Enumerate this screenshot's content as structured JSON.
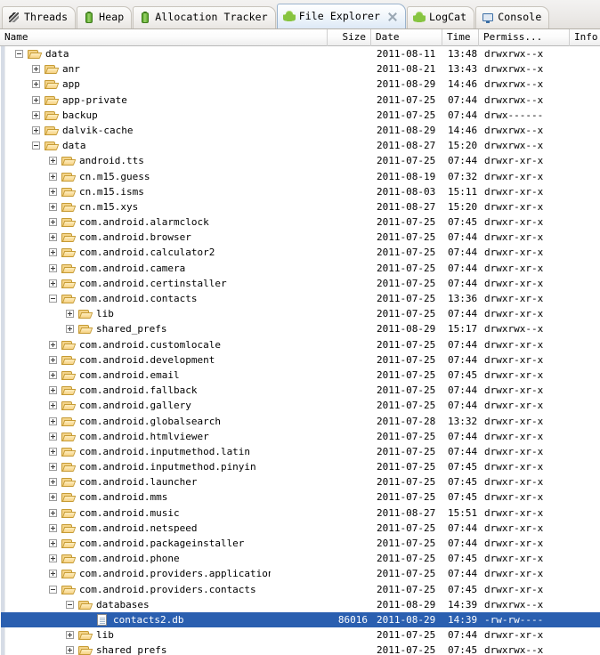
{
  "tabs": [
    {
      "label": "Threads",
      "icon": "threads-icon",
      "active": false,
      "closable": false
    },
    {
      "label": "Heap",
      "icon": "heap-icon",
      "active": false,
      "closable": false
    },
    {
      "label": "Allocation Tracker",
      "icon": "heap-icon",
      "active": false,
      "closable": false
    },
    {
      "label": "File Explorer",
      "icon": "android-icon",
      "active": true,
      "closable": true
    },
    {
      "label": "LogCat",
      "icon": "android-icon",
      "active": false,
      "closable": false
    },
    {
      "label": "Console",
      "icon": "console-icon",
      "active": false,
      "closable": false
    }
  ],
  "columns": [
    {
      "label": "Name",
      "align": "left"
    },
    {
      "label": "Size",
      "align": "right"
    },
    {
      "label": "Date",
      "align": "left"
    },
    {
      "label": "Time",
      "align": "left"
    },
    {
      "label": "Permiss...",
      "align": "left"
    },
    {
      "label": "Info",
      "align": "left"
    }
  ],
  "colors": {
    "selection": "#2a5fb0",
    "folder": "#f4d48a",
    "android_green": "#87c440"
  },
  "rows": [
    {
      "depth": 0,
      "icon": "folder-icon",
      "expander": "minus",
      "name": "data",
      "size": "",
      "date": "2011-08-11",
      "time": "13:48",
      "perm": "drwxrwx--x",
      "info": "",
      "selected": false
    },
    {
      "depth": 1,
      "icon": "folder-icon",
      "expander": "plus",
      "name": "anr",
      "size": "",
      "date": "2011-08-21",
      "time": "13:43",
      "perm": "drwxrwx--x",
      "info": "",
      "selected": false
    },
    {
      "depth": 1,
      "icon": "folder-icon",
      "expander": "plus",
      "name": "app",
      "size": "",
      "date": "2011-08-29",
      "time": "14:46",
      "perm": "drwxrwx--x",
      "info": "",
      "selected": false
    },
    {
      "depth": 1,
      "icon": "folder-icon",
      "expander": "plus",
      "name": "app-private",
      "size": "",
      "date": "2011-07-25",
      "time": "07:44",
      "perm": "drwxrwx--x",
      "info": "",
      "selected": false
    },
    {
      "depth": 1,
      "icon": "folder-icon",
      "expander": "plus",
      "name": "backup",
      "size": "",
      "date": "2011-07-25",
      "time": "07:44",
      "perm": "drwx------",
      "info": "",
      "selected": false
    },
    {
      "depth": 1,
      "icon": "folder-icon",
      "expander": "plus",
      "name": "dalvik-cache",
      "size": "",
      "date": "2011-08-29",
      "time": "14:46",
      "perm": "drwxrwx--x",
      "info": "",
      "selected": false
    },
    {
      "depth": 1,
      "icon": "folder-icon",
      "expander": "minus",
      "name": "data",
      "size": "",
      "date": "2011-08-27",
      "time": "15:20",
      "perm": "drwxrwx--x",
      "info": "",
      "selected": false
    },
    {
      "depth": 2,
      "icon": "folder-icon",
      "expander": "plus",
      "name": "android.tts",
      "size": "",
      "date": "2011-07-25",
      "time": "07:44",
      "perm": "drwxr-xr-x",
      "info": "",
      "selected": false
    },
    {
      "depth": 2,
      "icon": "folder-icon",
      "expander": "plus",
      "name": "cn.m15.guess",
      "size": "",
      "date": "2011-08-19",
      "time": "07:32",
      "perm": "drwxr-xr-x",
      "info": "",
      "selected": false
    },
    {
      "depth": 2,
      "icon": "folder-icon",
      "expander": "plus",
      "name": "cn.m15.isms",
      "size": "",
      "date": "2011-08-03",
      "time": "15:11",
      "perm": "drwxr-xr-x",
      "info": "",
      "selected": false
    },
    {
      "depth": 2,
      "icon": "folder-icon",
      "expander": "plus",
      "name": "cn.m15.xys",
      "size": "",
      "date": "2011-08-27",
      "time": "15:20",
      "perm": "drwxr-xr-x",
      "info": "",
      "selected": false
    },
    {
      "depth": 2,
      "icon": "folder-icon",
      "expander": "plus",
      "name": "com.android.alarmclock",
      "size": "",
      "date": "2011-07-25",
      "time": "07:45",
      "perm": "drwxr-xr-x",
      "info": "",
      "selected": false
    },
    {
      "depth": 2,
      "icon": "folder-icon",
      "expander": "plus",
      "name": "com.android.browser",
      "size": "",
      "date": "2011-07-25",
      "time": "07:44",
      "perm": "drwxr-xr-x",
      "info": "",
      "selected": false
    },
    {
      "depth": 2,
      "icon": "folder-icon",
      "expander": "plus",
      "name": "com.android.calculator2",
      "size": "",
      "date": "2011-07-25",
      "time": "07:44",
      "perm": "drwxr-xr-x",
      "info": "",
      "selected": false
    },
    {
      "depth": 2,
      "icon": "folder-icon",
      "expander": "plus",
      "name": "com.android.camera",
      "size": "",
      "date": "2011-07-25",
      "time": "07:44",
      "perm": "drwxr-xr-x",
      "info": "",
      "selected": false
    },
    {
      "depth": 2,
      "icon": "folder-icon",
      "expander": "plus",
      "name": "com.android.certinstaller",
      "size": "",
      "date": "2011-07-25",
      "time": "07:44",
      "perm": "drwxr-xr-x",
      "info": "",
      "selected": false
    },
    {
      "depth": 2,
      "icon": "folder-icon",
      "expander": "minus",
      "name": "com.android.contacts",
      "size": "",
      "date": "2011-07-25",
      "time": "13:36",
      "perm": "drwxr-xr-x",
      "info": "",
      "selected": false
    },
    {
      "depth": 3,
      "icon": "folder-icon",
      "expander": "plus",
      "name": "lib",
      "size": "",
      "date": "2011-07-25",
      "time": "07:44",
      "perm": "drwxr-xr-x",
      "info": "",
      "selected": false
    },
    {
      "depth": 3,
      "icon": "folder-icon",
      "expander": "plus",
      "name": "shared_prefs",
      "size": "",
      "date": "2011-08-29",
      "time": "15:17",
      "perm": "drwxrwx--x",
      "info": "",
      "selected": false
    },
    {
      "depth": 2,
      "icon": "folder-icon",
      "expander": "plus",
      "name": "com.android.customlocale",
      "size": "",
      "date": "2011-07-25",
      "time": "07:44",
      "perm": "drwxr-xr-x",
      "info": "",
      "selected": false
    },
    {
      "depth": 2,
      "icon": "folder-icon",
      "expander": "plus",
      "name": "com.android.development",
      "size": "",
      "date": "2011-07-25",
      "time": "07:44",
      "perm": "drwxr-xr-x",
      "info": "",
      "selected": false
    },
    {
      "depth": 2,
      "icon": "folder-icon",
      "expander": "plus",
      "name": "com.android.email",
      "size": "",
      "date": "2011-07-25",
      "time": "07:45",
      "perm": "drwxr-xr-x",
      "info": "",
      "selected": false
    },
    {
      "depth": 2,
      "icon": "folder-icon",
      "expander": "plus",
      "name": "com.android.fallback",
      "size": "",
      "date": "2011-07-25",
      "time": "07:44",
      "perm": "drwxr-xr-x",
      "info": "",
      "selected": false
    },
    {
      "depth": 2,
      "icon": "folder-icon",
      "expander": "plus",
      "name": "com.android.gallery",
      "size": "",
      "date": "2011-07-25",
      "time": "07:44",
      "perm": "drwxr-xr-x",
      "info": "",
      "selected": false
    },
    {
      "depth": 2,
      "icon": "folder-icon",
      "expander": "plus",
      "name": "com.android.globalsearch",
      "size": "",
      "date": "2011-07-28",
      "time": "13:32",
      "perm": "drwxr-xr-x",
      "info": "",
      "selected": false
    },
    {
      "depth": 2,
      "icon": "folder-icon",
      "expander": "plus",
      "name": "com.android.htmlviewer",
      "size": "",
      "date": "2011-07-25",
      "time": "07:44",
      "perm": "drwxr-xr-x",
      "info": "",
      "selected": false
    },
    {
      "depth": 2,
      "icon": "folder-icon",
      "expander": "plus",
      "name": "com.android.inputmethod.latin",
      "size": "",
      "date": "2011-07-25",
      "time": "07:44",
      "perm": "drwxr-xr-x",
      "info": "",
      "selected": false
    },
    {
      "depth": 2,
      "icon": "folder-icon",
      "expander": "plus",
      "name": "com.android.inputmethod.pinyin",
      "size": "",
      "date": "2011-07-25",
      "time": "07:45",
      "perm": "drwxr-xr-x",
      "info": "",
      "selected": false
    },
    {
      "depth": 2,
      "icon": "folder-icon",
      "expander": "plus",
      "name": "com.android.launcher",
      "size": "",
      "date": "2011-07-25",
      "time": "07:45",
      "perm": "drwxr-xr-x",
      "info": "",
      "selected": false
    },
    {
      "depth": 2,
      "icon": "folder-icon",
      "expander": "plus",
      "name": "com.android.mms",
      "size": "",
      "date": "2011-07-25",
      "time": "07:45",
      "perm": "drwxr-xr-x",
      "info": "",
      "selected": false
    },
    {
      "depth": 2,
      "icon": "folder-icon",
      "expander": "plus",
      "name": "com.android.music",
      "size": "",
      "date": "2011-08-27",
      "time": "15:51",
      "perm": "drwxr-xr-x",
      "info": "",
      "selected": false
    },
    {
      "depth": 2,
      "icon": "folder-icon",
      "expander": "plus",
      "name": "com.android.netspeed",
      "size": "",
      "date": "2011-07-25",
      "time": "07:44",
      "perm": "drwxr-xr-x",
      "info": "",
      "selected": false
    },
    {
      "depth": 2,
      "icon": "folder-icon",
      "expander": "plus",
      "name": "com.android.packageinstaller",
      "size": "",
      "date": "2011-07-25",
      "time": "07:44",
      "perm": "drwxr-xr-x",
      "info": "",
      "selected": false
    },
    {
      "depth": 2,
      "icon": "folder-icon",
      "expander": "plus",
      "name": "com.android.phone",
      "size": "",
      "date": "2011-07-25",
      "time": "07:45",
      "perm": "drwxr-xr-x",
      "info": "",
      "selected": false
    },
    {
      "depth": 2,
      "icon": "folder-icon",
      "expander": "plus",
      "name": "com.android.providers.applications",
      "size": "",
      "date": "2011-07-25",
      "time": "07:44",
      "perm": "drwxr-xr-x",
      "info": "",
      "selected": false
    },
    {
      "depth": 2,
      "icon": "folder-icon",
      "expander": "minus",
      "name": "com.android.providers.contacts",
      "size": "",
      "date": "2011-07-25",
      "time": "07:45",
      "perm": "drwxr-xr-x",
      "info": "",
      "selected": false
    },
    {
      "depth": 3,
      "icon": "folder-icon",
      "expander": "minus",
      "name": "databases",
      "size": "",
      "date": "2011-08-29",
      "time": "14:39",
      "perm": "drwxrwx--x",
      "info": "",
      "selected": false
    },
    {
      "depth": 4,
      "icon": "file-icon",
      "expander": "none",
      "name": "contacts2.db",
      "size": "86016",
      "date": "2011-08-29",
      "time": "14:39",
      "perm": "-rw-rw----",
      "info": "",
      "selected": true
    },
    {
      "depth": 3,
      "icon": "folder-icon",
      "expander": "plus",
      "name": "lib",
      "size": "",
      "date": "2011-07-25",
      "time": "07:44",
      "perm": "drwxr-xr-x",
      "info": "",
      "selected": false
    },
    {
      "depth": 3,
      "icon": "folder-icon",
      "expander": "plus",
      "name": "shared_prefs",
      "size": "",
      "date": "2011-07-25",
      "time": "07:45",
      "perm": "drwxrwx--x",
      "info": "",
      "selected": false
    }
  ]
}
